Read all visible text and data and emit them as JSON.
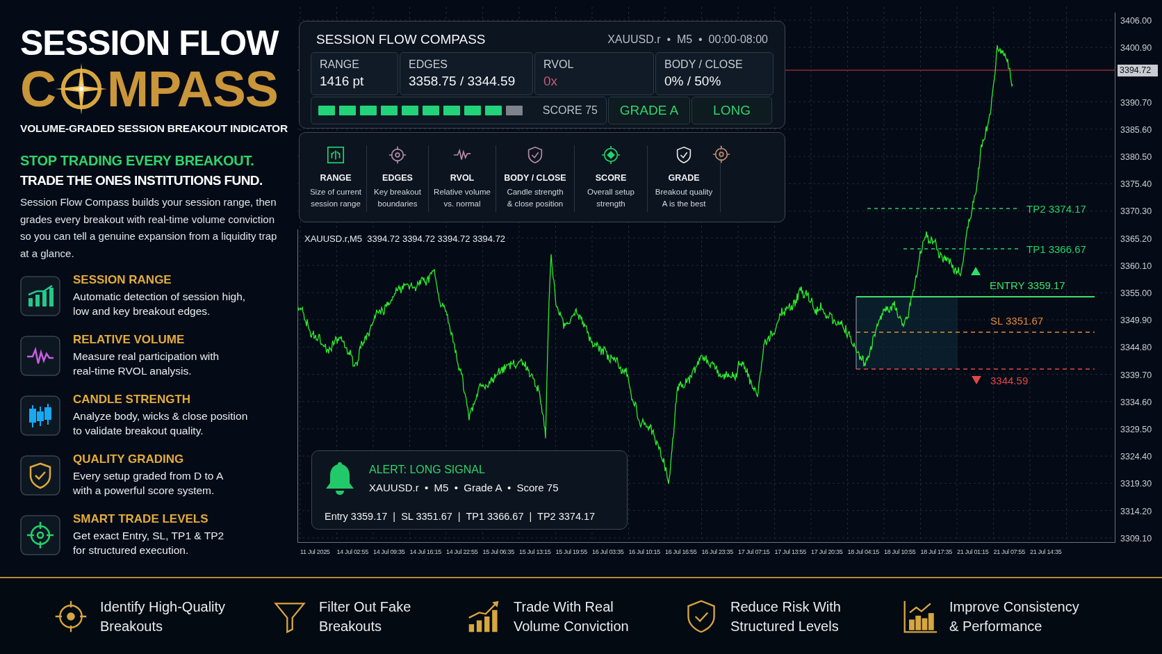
{
  "logo": {
    "line1": "SESSION FLOW",
    "line2_start": "C",
    "line2_end": "MPASS",
    "tagline": "VOLUME-GRADED SESSION BREAKOUT INDICATOR"
  },
  "headline": {
    "accent": "STOP TRADING EVERY BREAKOUT.",
    "main": "TRADE THE ONES INSTITUTIONS FUND.",
    "body": "Session Flow Compass builds your session range, then grades every breakout with real-time volume conviction so you can tell a genuine expansion from a liquidity trap at a glance."
  },
  "features": [
    {
      "title": "SESSION RANGE",
      "desc": "Automatic detection of session high,\nlow and key breakout edges."
    },
    {
      "title": "RELATIVE VOLUME",
      "desc": "Measure real participation with\nreal-time RVOL analysis."
    },
    {
      "title": "CANDLE STRENGTH",
      "desc": "Analyze body, wicks & close position\nto validate breakout quality."
    },
    {
      "title": "QUALITY GRADING",
      "desc": "Every setup graded from D to A\nwith a powerful score system."
    },
    {
      "title": "SMART TRADE LEVELS",
      "desc": "Get exact Entry, SL, TP1 & TP2\nfor structured execution."
    }
  ],
  "dashboard": {
    "title": "SESSION FLOW COMPASS",
    "meta": "XAUUSD.r  •  M5  •  00:00-08:00",
    "stats": [
      {
        "label": "RANGE",
        "value": "1416 pt",
        "dimmed": false
      },
      {
        "label": "EDGES",
        "value": "3358.75 / 3344.59",
        "dimmed": false
      },
      {
        "label": "RVOL",
        "value": "0x",
        "dimmed": true
      },
      {
        "label": "BODY / CLOSE",
        "value": "0% / 50%",
        "dimmed": false
      }
    ],
    "score": {
      "level": 0.9,
      "label": "SCORE 75"
    },
    "grade": "GRADE A",
    "direction": "LONG"
  },
  "legend": [
    {
      "title": "RANGE",
      "desc": "Size of current\nsession range"
    },
    {
      "title": "EDGES",
      "desc": "Key breakout\nboundaries"
    },
    {
      "title": "RVOL",
      "desc": "Relative volume\nvs. normal"
    },
    {
      "title": "BODY / CLOSE",
      "desc": "Candle strength\n& close position"
    },
    {
      "title": "SCORE",
      "desc": "Overall setup\nstrength"
    },
    {
      "title": "GRADE",
      "desc": "Breakout quality\nA is the best"
    }
  ],
  "chart": {
    "caption": "XAUUSD.r,M5  3394.72 3394.72 3394.72 3394.72",
    "current_price": "3394.72",
    "price_ticks": [
      "3406.00",
      "3400.90",
      "3390.70",
      "3385.60",
      "3380.50",
      "3375.40",
      "3370.30",
      "3365.20",
      "3360.10",
      "3355.00",
      "3349.90",
      "3344.80",
      "3339.70",
      "3334.60",
      "3329.50",
      "3324.40",
      "3319.30",
      "3314.20",
      "3309.10"
    ],
    "time_ticks": [
      "11 Jul 2025",
      "14 Jul 02:55",
      "14 Jul 09:35",
      "14 Jul 16:15",
      "14 Jul 22:55",
      "15 Jul 06:35",
      "15 Jul 13:15",
      "15 Jul 19:55",
      "16 Jul 03:35",
      "16 Jul 10:15",
      "16 Jul 16:55",
      "16 Jul 23:35",
      "17 Jul 07:15",
      "17 Jul 13:55",
      "17 Jul 20:35",
      "18 Jul 04:15",
      "18 Jul 10:55",
      "18 Jul 17:35",
      "21 Jul 01:15",
      "21 Jul 07:55",
      "21 Jul 14:35"
    ],
    "levels": [
      {
        "kind": "tp",
        "text": "TP2  3374.17"
      },
      {
        "kind": "tp",
        "text": "TP1  3366.67"
      },
      {
        "kind": "entry",
        "text": "ENTRY  3359.17"
      },
      {
        "kind": "sl",
        "text": "SL  3351.67"
      },
      {
        "kind": "low",
        "text": "3344.59"
      }
    ]
  },
  "alert": {
    "title": "ALERT: LONG SIGNAL",
    "details": "XAUUSD.r  •  M5  •  Grade A  •  Score 75",
    "levels": "Entry 3359.17  |  SL 3351.67  |  TP1 3366.67  |  TP2 3374.17"
  },
  "benefits": [
    {
      "text": "Identify High-Quality\nBreakouts"
    },
    {
      "text": "Filter Out Fake\nBreakouts"
    },
    {
      "text": "Trade With Real\nVolume Conviction"
    },
    {
      "text": "Reduce Risk With\nStructured Levels"
    },
    {
      "text": "Improve Consistency\n& Performance"
    }
  ]
}
